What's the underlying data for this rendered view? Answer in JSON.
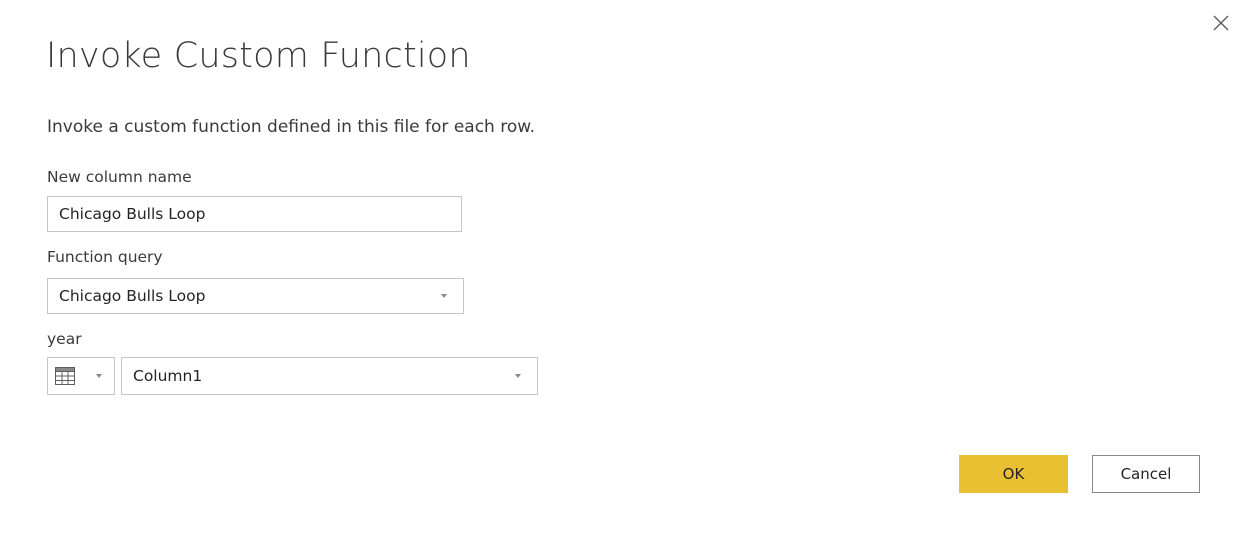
{
  "dialog": {
    "title": "Invoke Custom Function",
    "subtitle": "Invoke a custom function defined in this file for each row."
  },
  "fields": {
    "new_column_name": {
      "label": "New column name",
      "value": "Chicago Bulls Loop"
    },
    "function_query": {
      "label": "Function query",
      "selected": "Chicago Bulls Loop"
    },
    "year": {
      "label": "year",
      "type_icon": "table-icon",
      "selected": "Column1"
    }
  },
  "buttons": {
    "ok_label": "OK",
    "cancel_label": "Cancel"
  },
  "colors": {
    "primary_button": "#e8c031",
    "border": "#c8c6c4",
    "text": "#252423"
  }
}
